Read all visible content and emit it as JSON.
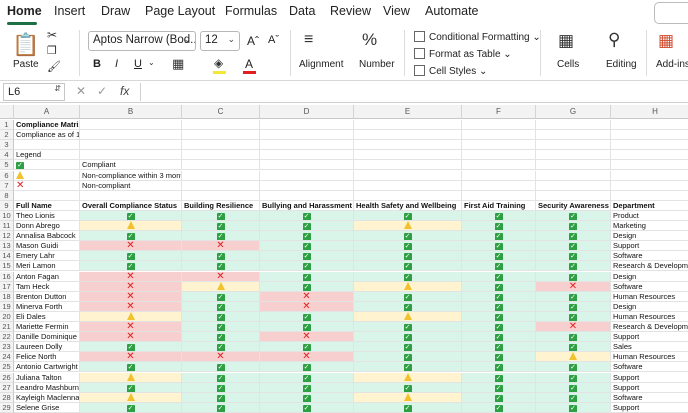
{
  "tabs": [
    "Home",
    "Insert",
    "Draw",
    "Page Layout",
    "Formulas",
    "Data",
    "Review",
    "View",
    "Automate"
  ],
  "ribbon": {
    "paste": "Paste",
    "font_name": "Aptos Narrow (Bod...",
    "font_size": "12",
    "grow": "Aˆ",
    "shrink": "Aˇ",
    "bold": "B",
    "italic": "I",
    "underline": "U",
    "font_color": "A",
    "alignment": "Alignment",
    "number": "Number",
    "conditional_formatting": "Conditional Formatting",
    "format_as_table": "Format as Table",
    "cell_styles": "Cell Styles",
    "cells": "Cells",
    "editing": "Editing",
    "addins": "Add-ins"
  },
  "formula_bar": {
    "name_box": "L6",
    "fx": "fx",
    "formula": ""
  },
  "columns": [
    "A",
    "B",
    "C",
    "D",
    "E",
    "F",
    "G",
    "H"
  ],
  "sheet": {
    "title": "Compliance Matrix Report",
    "as_of": "Compliance as of 14/09/2024",
    "legend_label": "Legend",
    "legend": [
      {
        "icon": "yes",
        "text": "Compliant"
      },
      {
        "icon": "warn",
        "text": "Non-compliance within 3 months"
      },
      {
        "icon": "no",
        "text": "Non-compliant"
      }
    ],
    "headers": [
      "Full Name",
      "Overall Compliance Status",
      "Building Resilience",
      "Bullying and Harassment",
      "Health Safety and Wellbeing",
      "First Aid Training",
      "Security Awareness",
      "Department"
    ],
    "rows": [
      {
        "name": "Theo Lionis",
        "status": [
          "yes",
          "yes",
          "yes",
          "yes",
          "yes",
          "yes"
        ],
        "dept": "Product"
      },
      {
        "name": "Donn Abrego",
        "status": [
          "warn",
          "yes",
          "yes",
          "warn",
          "yes",
          "yes"
        ],
        "dept": "Marketing"
      },
      {
        "name": "Annalisa Babcock",
        "status": [
          "yes",
          "yes",
          "yes",
          "yes",
          "yes",
          "yes"
        ],
        "dept": "Design"
      },
      {
        "name": "Mason Guidi",
        "status": [
          "no",
          "no",
          "yes",
          "yes",
          "yes",
          "yes"
        ],
        "dept": "Support"
      },
      {
        "name": "Emery Lahr",
        "status": [
          "yes",
          "yes",
          "yes",
          "yes",
          "yes",
          "yes"
        ],
        "dept": "Software"
      },
      {
        "name": "Meri Lamon",
        "status": [
          "yes",
          "yes",
          "yes",
          "yes",
          "yes",
          "yes"
        ],
        "dept": "Research & Development"
      },
      {
        "name": "Anton Fagan",
        "status": [
          "no",
          "no",
          "yes",
          "yes",
          "yes",
          "yes"
        ],
        "dept": "Design"
      },
      {
        "name": "Tam Heck",
        "status": [
          "no",
          "warn",
          "yes",
          "warn",
          "yes",
          "no"
        ],
        "dept": "Software"
      },
      {
        "name": "Brenton Dutton",
        "status": [
          "no",
          "yes",
          "no",
          "yes",
          "yes",
          "yes"
        ],
        "dept": "Human Resources"
      },
      {
        "name": "Minerva Forth",
        "status": [
          "no",
          "yes",
          "no",
          "yes",
          "yes",
          "yes"
        ],
        "dept": "Design"
      },
      {
        "name": "Eli Dales",
        "status": [
          "warn",
          "yes",
          "yes",
          "warn",
          "yes",
          "yes"
        ],
        "dept": "Human Resources"
      },
      {
        "name": "Mariette Fermin",
        "status": [
          "no",
          "yes",
          "yes",
          "yes",
          "yes",
          "no"
        ],
        "dept": "Research & Development"
      },
      {
        "name": "Danille Dominique",
        "status": [
          "no",
          "yes",
          "no",
          "yes",
          "yes",
          "yes"
        ],
        "dept": "Support"
      },
      {
        "name": "Laureen Dolly",
        "status": [
          "yes",
          "yes",
          "yes",
          "yes",
          "yes",
          "yes"
        ],
        "dept": "Sales"
      },
      {
        "name": "Felice North",
        "status": [
          "no",
          "no",
          "no",
          "yes",
          "yes",
          "warn"
        ],
        "dept": "Human Resources"
      },
      {
        "name": "Antonio Cartwright",
        "status": [
          "yes",
          "yes",
          "yes",
          "yes",
          "yes",
          "yes"
        ],
        "dept": "Software"
      },
      {
        "name": "Juliana Talton",
        "status": [
          "warn",
          "yes",
          "yes",
          "warn",
          "yes",
          "yes"
        ],
        "dept": "Support"
      },
      {
        "name": "Leandro Mashburn",
        "status": [
          "yes",
          "yes",
          "yes",
          "yes",
          "yes",
          "yes"
        ],
        "dept": "Support"
      },
      {
        "name": "Kayleigh Maclennan",
        "status": [
          "warn",
          "yes",
          "yes",
          "warn",
          "yes",
          "yes"
        ],
        "dept": "Software"
      },
      {
        "name": "Selene Grise",
        "status": [
          "yes",
          "yes",
          "yes",
          "yes",
          "yes",
          "yes"
        ],
        "dept": "Support"
      }
    ]
  },
  "colors": {
    "green_fill": "#d9f5ea",
    "yellow_fill": "#fff4cf",
    "red_fill": "#f8cfcf",
    "accent": "#1e7145"
  }
}
